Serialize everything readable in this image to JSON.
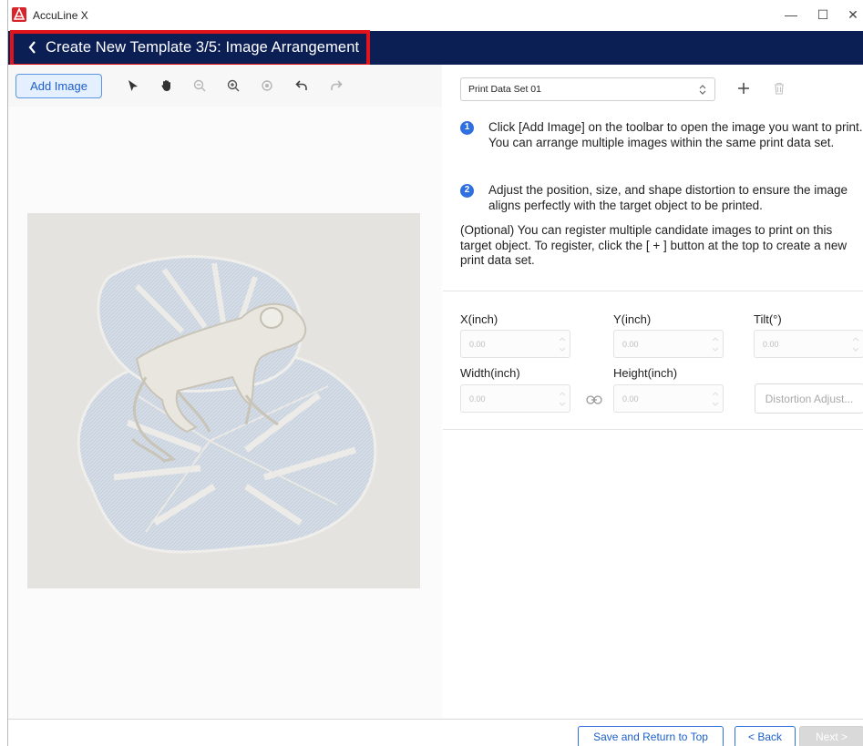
{
  "window": {
    "app_title": "AccuLine X",
    "minimize": "—",
    "maximize": "☐",
    "close": "✕"
  },
  "header": {
    "title": "Create New Template 3/5: Image Arrangement",
    "background": "#0c1f55",
    "highlight_color": "#e1141b"
  },
  "toolbar": {
    "add_image_label": "Add Image",
    "tools": [
      "select-arrow-icon",
      "hand-pan-icon",
      "zoom-out-icon",
      "zoom-in-icon",
      "preview-eye-icon",
      "undo-icon",
      "redo-icon"
    ]
  },
  "data_set": {
    "selected": "Print Data Set 01"
  },
  "instructions": {
    "step1_number": "1",
    "step1_text": "Click [Add Image] on the toolbar to open the image you want to print. You can arrange multiple images within the same print data set.",
    "step2_number": "2",
    "step2_text": "Adjust the position, size, and shape distortion to ensure the image aligns perfectly with the target object to be printed.",
    "optional_text": "(Optional) You can register multiple candidate images to print on this target object. To register, click the [ + ] button at the top to create a new print data set."
  },
  "properties": {
    "x_label": "X(inch)",
    "x_value": "0.00",
    "y_label": "Y(inch)",
    "y_value": "0.00",
    "tilt_label": "Tilt(°)",
    "tilt_value": "0.00",
    "width_label": "Width(inch)",
    "width_value": "0.00",
    "height_label": "Height(inch)",
    "height_value": "0.00",
    "distortion_label": "Distortion Adjust..."
  },
  "footer": {
    "save_label": "Save and Return to Top",
    "back_label": "< Back",
    "next_label": "Next >"
  },
  "colors": {
    "accent": "#2f6fe0",
    "brand_red": "#d8232a"
  }
}
